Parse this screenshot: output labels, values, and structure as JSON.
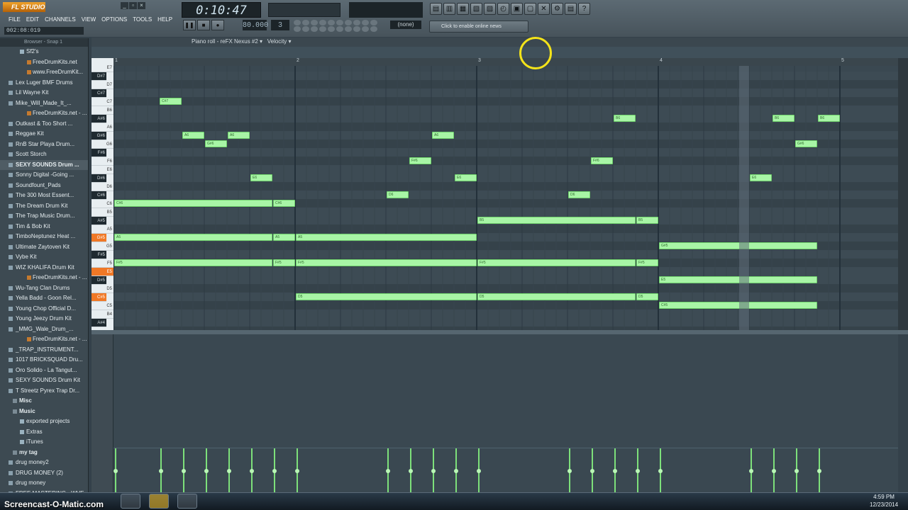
{
  "app": {
    "logo": "FL STUDIO",
    "menu": [
      "FILE",
      "EDIT",
      "CHANNELS",
      "VIEW",
      "OPTIONS",
      "TOOLS",
      "HELP"
    ],
    "position_readout": "002:08:019",
    "time": "0:10:47",
    "tempo": "80.000",
    "pattern": "3",
    "snap": "(none)",
    "online_news_hint": "Click to enable online news"
  },
  "browser": {
    "header": "Browser - Snap 1",
    "items": [
      {
        "label": "Sf2's",
        "type": "folder"
      },
      {
        "label": "FreeDrumKits.net",
        "type": "sub"
      },
      {
        "label": "www.FreeDrumKit...",
        "type": "sub"
      },
      {
        "label": "Lex Luger BMF Drums",
        "type": "item"
      },
      {
        "label": "Lil Wayne Kit",
        "type": "item"
      },
      {
        "label": "Mike_Will_Made_It_...",
        "type": "item"
      },
      {
        "label": "FreeDrumKits.net - ...",
        "type": "sub"
      },
      {
        "label": "Outkast & Too Short ...",
        "type": "item"
      },
      {
        "label": "Reggae Kit",
        "type": "item"
      },
      {
        "label": "RnB Star Playa Drum...",
        "type": "item"
      },
      {
        "label": "Scott Storch",
        "type": "item"
      },
      {
        "label": "SEXY SOUNDS Drum ...",
        "type": "selected"
      },
      {
        "label": "Sonny Digital -Going ...",
        "type": "item"
      },
      {
        "label": "Soundfount_Pads",
        "type": "item"
      },
      {
        "label": "The 300 Most Essent...",
        "type": "item"
      },
      {
        "label": "The Dream Drum Kit",
        "type": "item"
      },
      {
        "label": "The Trap Music Drum...",
        "type": "item"
      },
      {
        "label": "Tim & Bob Kit",
        "type": "item"
      },
      {
        "label": "TimboNeptunez Heat ...",
        "type": "item"
      },
      {
        "label": "Ultimate Zaytoven Kit",
        "type": "item"
      },
      {
        "label": "Vybe Kit",
        "type": "item"
      },
      {
        "label": "WIZ KHALIFA Drum Kit",
        "type": "item"
      },
      {
        "label": "FreeDrumKits.net - ...",
        "type": "sub"
      },
      {
        "label": "Wu-Tang Clan Drums",
        "type": "item"
      },
      {
        "label": "Yella Badd - Goon Rel...",
        "type": "item"
      },
      {
        "label": "Young Chop Official D...",
        "type": "item"
      },
      {
        "label": "Young Jeezy Drum Kit",
        "type": "item"
      },
      {
        "label": "_MMG_Wale_Drum_...",
        "type": "item"
      },
      {
        "label": "FreeDrumKits.net - ...",
        "type": "sub"
      },
      {
        "label": "_TRAP_INSTRUMENT...",
        "type": "item"
      },
      {
        "label": "1017 BRICKSQUAD Dru...",
        "type": "root"
      },
      {
        "label": "Oro Solido - La Tangut...",
        "type": "root"
      },
      {
        "label": "SEXY SOUNDS Drum Kit",
        "type": "root"
      },
      {
        "label": "T Streetz Pyrex Trap Dr...",
        "type": "root"
      },
      {
        "label": "Misc",
        "type": "cat"
      },
      {
        "label": "Music",
        "type": "cat"
      },
      {
        "label": "exported projects",
        "type": "folder2"
      },
      {
        "label": "Extras",
        "type": "folder2"
      },
      {
        "label": "iTunes",
        "type": "folder2"
      },
      {
        "label": "my tag",
        "type": "cat"
      },
      {
        "label": "drug money2",
        "type": "root"
      },
      {
        "label": "DRUG MONEY (2)",
        "type": "root"
      },
      {
        "label": "drug money",
        "type": "root"
      },
      {
        "label": "FREE MASTERING - WVE",
        "type": "root"
      }
    ]
  },
  "piano_roll": {
    "title": "Piano roll - reFX Nexus #2",
    "target": "Velocity",
    "bars": [
      "1",
      "2",
      "3",
      "4",
      "5"
    ],
    "keys": [
      "E7",
      "D#7",
      "D7",
      "C#7",
      "C7",
      "B6",
      "A#6",
      "A6",
      "G#6",
      "G6",
      "F#6",
      "F6",
      "E6",
      "D#6",
      "D6",
      "C#6",
      "C6",
      "B5",
      "A#5",
      "A5",
      "G#5",
      "G5",
      "F#5",
      "F5",
      "E5",
      "D#5",
      "D5",
      "C#5",
      "C5",
      "B4",
      "A#4"
    ],
    "highlighted_keys": [
      "G#5",
      "E5",
      "C#5"
    ],
    "notes": [
      {
        "pitch": "C#7",
        "start": 1.25,
        "len": 0.125
      },
      {
        "pitch": "A6",
        "start": 1.375,
        "len": 0.125
      },
      {
        "pitch": "G#6",
        "start": 1.5,
        "len": 0.125
      },
      {
        "pitch": "A6",
        "start": 1.625,
        "len": 0.125
      },
      {
        "pitch": "E6",
        "start": 1.75,
        "len": 0.125
      },
      {
        "pitch": "C#6",
        "start": 1.0,
        "len": 0.875
      },
      {
        "pitch": "C#6",
        "start": 1.875,
        "len": 0.125
      },
      {
        "pitch": "A5",
        "start": 1.0,
        "len": 0.875
      },
      {
        "pitch": "A5",
        "start": 1.875,
        "len": 0.125
      },
      {
        "pitch": "A5",
        "start": 2.0,
        "len": 1.0
      },
      {
        "pitch": "F#5",
        "start": 1.0,
        "len": 0.875
      },
      {
        "pitch": "F#5",
        "start": 1.875,
        "len": 0.125
      },
      {
        "pitch": "F#5",
        "start": 2.0,
        "len": 1.0
      },
      {
        "pitch": "D5",
        "start": 2.0,
        "len": 1.0
      },
      {
        "pitch": "D6",
        "start": 2.5,
        "len": 0.125
      },
      {
        "pitch": "F#6",
        "start": 2.625,
        "len": 0.125
      },
      {
        "pitch": "A6",
        "start": 2.75,
        "len": 0.125
      },
      {
        "pitch": "E6",
        "start": 2.875,
        "len": 0.125
      },
      {
        "pitch": "B5",
        "start": 3.0,
        "len": 0.875
      },
      {
        "pitch": "B5",
        "start": 3.875,
        "len": 0.125
      },
      {
        "pitch": "F#5",
        "start": 3.0,
        "len": 0.875
      },
      {
        "pitch": "F#5",
        "start": 3.875,
        "len": 0.125
      },
      {
        "pitch": "D5",
        "start": 3.0,
        "len": 0.875
      },
      {
        "pitch": "D5",
        "start": 3.875,
        "len": 0.125
      },
      {
        "pitch": "D6",
        "start": 3.5,
        "len": 0.125
      },
      {
        "pitch": "F#6",
        "start": 3.625,
        "len": 0.125
      },
      {
        "pitch": "B6",
        "start": 3.75,
        "len": 0.125
      },
      {
        "pitch": "G#5",
        "start": 4.0,
        "len": 0.875
      },
      {
        "pitch": "E5",
        "start": 4.0,
        "len": 0.875
      },
      {
        "pitch": "C#5",
        "start": 4.0,
        "len": 0.875
      },
      {
        "pitch": "E6",
        "start": 4.5,
        "len": 0.125
      },
      {
        "pitch": "B6",
        "start": 4.625,
        "len": 0.125
      },
      {
        "pitch": "G#6",
        "start": 4.75,
        "len": 0.125
      },
      {
        "pitch": "B6",
        "start": 4.875,
        "len": 0.125
      }
    ]
  },
  "taskbar": {
    "watermark": "Screencast-O-Matic.com",
    "clock_time": "4:59 PM",
    "clock_date": "12/23/2014"
  },
  "colors": {
    "note_fill": "#a8f5a6",
    "grid_bg": "#3a4851",
    "key_highlight": "#f07826"
  }
}
